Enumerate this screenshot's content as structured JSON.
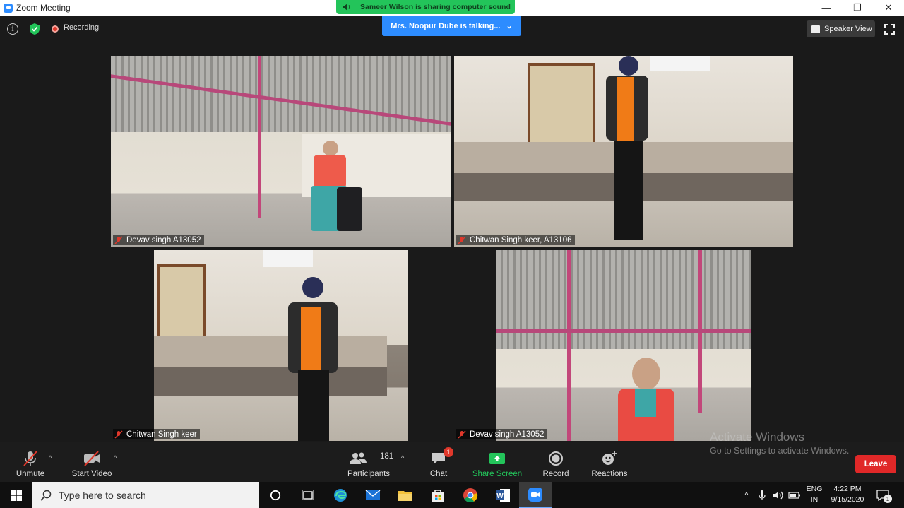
{
  "window": {
    "title": "Zoom Meeting",
    "controls": {
      "minimize": "—",
      "restore": "❐",
      "close": "✕"
    }
  },
  "banner": {
    "sharing_text": "Sameer Wilson is sharing computer sound"
  },
  "topbar": {
    "recording_label": "Recording",
    "talking_text": "Mrs. Noopur Dube is talking...",
    "talking_caret": "⌄",
    "speaker_view_label": "Speaker View"
  },
  "tiles": [
    {
      "name": "Devav singh A13052",
      "muted": true
    },
    {
      "name": "Chitwan Singh keer, A13106",
      "muted": true
    },
    {
      "name": "Chitwan Singh keer",
      "muted": true
    },
    {
      "name": "Devav singh A13052",
      "muted": true
    }
  ],
  "toolbar": {
    "unmute_label": "Unmute",
    "start_video_label": "Start Video",
    "participants_label": "Participants",
    "participants_count": "181",
    "chat_label": "Chat",
    "chat_badge": "1",
    "share_screen_label": "Share Screen",
    "record_label": "Record",
    "reactions_label": "Reactions",
    "leave_label": "Leave",
    "caret": "^"
  },
  "watermark": {
    "line1": "Activate Windows",
    "line2": "Go to Settings to activate Windows."
  },
  "taskbar": {
    "search_placeholder": "Type here to search",
    "tray_caret": "^",
    "lang_line1": "ENG",
    "lang_line2": "IN",
    "time": "4:22 PM",
    "date": "9/15/2020",
    "notification_count": "1"
  },
  "colors": {
    "zoom_blue": "#2d8cff",
    "share_green": "#23c45a",
    "leave_red": "#e02828",
    "stage_bg": "#1a1a1a"
  }
}
